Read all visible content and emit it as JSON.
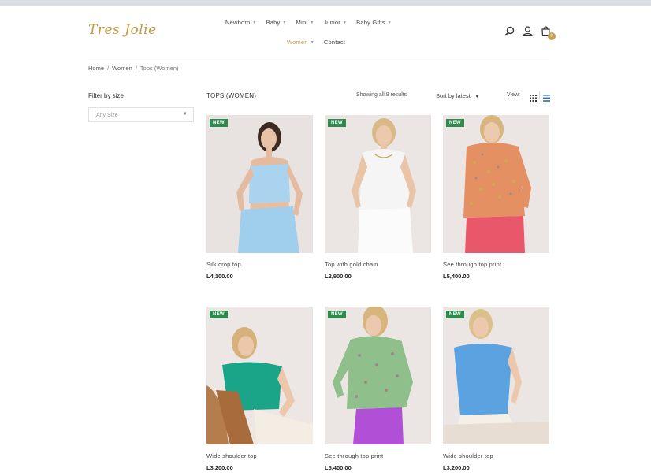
{
  "brand": {
    "logo_text": "Tres Jolie"
  },
  "nav": {
    "row1": [
      {
        "label": "Newborn",
        "has_dropdown": true
      },
      {
        "label": "Baby",
        "has_dropdown": true
      },
      {
        "label": "Mini",
        "has_dropdown": true
      },
      {
        "label": "Junior",
        "has_dropdown": true
      },
      {
        "label": "Baby Gifts",
        "has_dropdown": true
      }
    ],
    "row2": [
      {
        "label": "Women",
        "has_dropdown": true,
        "active": true
      },
      {
        "label": "Contact",
        "has_dropdown": false
      }
    ]
  },
  "header_icons": [
    "search-icon",
    "user-icon",
    "cart-icon"
  ],
  "cart": {
    "count": "0"
  },
  "breadcrumb": {
    "items": [
      "Home",
      "Women",
      "Tops (Women)"
    ],
    "separator": "/"
  },
  "sidebar": {
    "filter_title": "Filter by size",
    "size_select": {
      "value": "Any Size"
    }
  },
  "listing": {
    "category_title": "TOPS (WOMEN)",
    "results_text": "Showing all 9 results",
    "sort_label": "Sort by latest",
    "view_label": "View:"
  },
  "products": [
    {
      "name": "Silk crop top",
      "price": "L4,100.00",
      "badge": "NEW"
    },
    {
      "name": "Top with gold chain",
      "price": "L2,900.00",
      "badge": "NEW"
    },
    {
      "name": "See through top print",
      "price": "L5,400.00",
      "badge": "NEW"
    },
    {
      "name": "Wide shoulder top",
      "price": "L3,200.00",
      "badge": "NEW"
    },
    {
      "name": "See through top print",
      "price": "L5,400.00",
      "badge": "NEW"
    },
    {
      "name": "Wide shoulder top",
      "price": "L3,200.00",
      "badge": "NEW"
    }
  ],
  "colors": {
    "accent_gold": "#c5a054",
    "badge_green": "#2f8a4e",
    "photo_background": "#ece6e3"
  }
}
